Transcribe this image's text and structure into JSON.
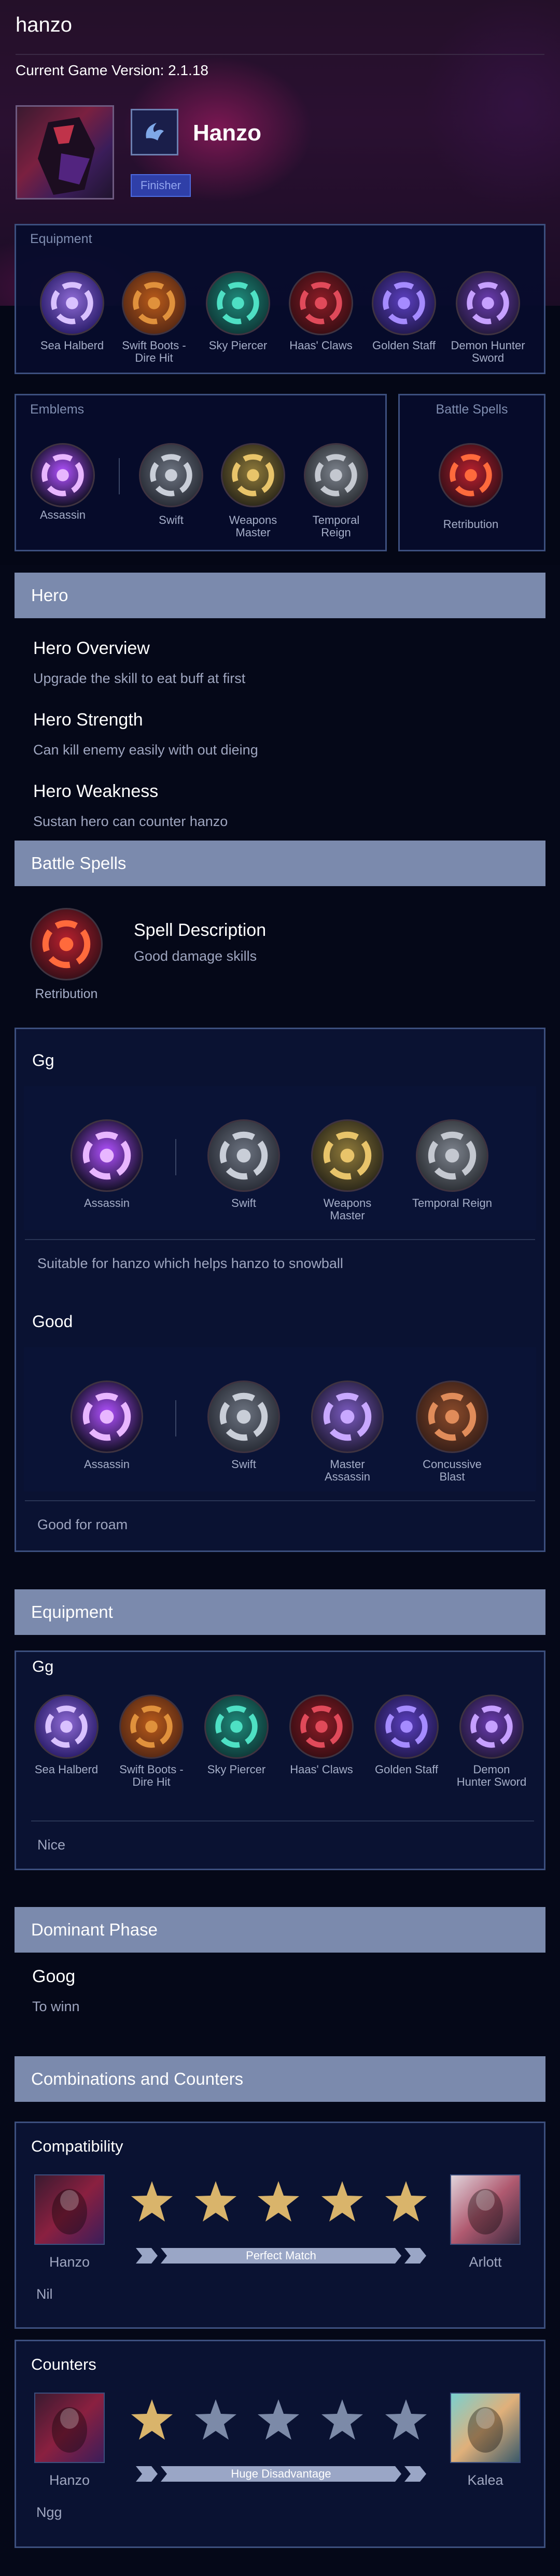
{
  "page_title": "hanzo",
  "version_text": "Current Game Version: 2.1.18",
  "hero": {
    "name": "Hanzo",
    "role_badge": "Finisher"
  },
  "top_equipment": {
    "title": "Equipment",
    "items": [
      "Sea Halberd",
      "Swift Boots - Dire Hit",
      "Sky Piercer",
      "Haas' Claws",
      "Golden Staff",
      "Demon Hunter Sword"
    ]
  },
  "top_emblems": {
    "title": "Emblems",
    "main": "Assassin",
    "talents": [
      "Swift",
      "Weapons Master",
      "Temporal Reign"
    ]
  },
  "top_spells": {
    "title": "Battle Spells",
    "spell": "Retribution"
  },
  "hero_section": {
    "title": "Hero",
    "overview_title": "Hero Overview",
    "overview": "Upgrade the skill to eat buff at first",
    "strength_title": "Hero Strength",
    "strength": "Can kill enemy easily with out dieing",
    "weakness_title": "Hero Weakness",
    "weakness": "Sustan hero can counter hanzo"
  },
  "spell_section": {
    "title": "Battle Spells",
    "spell": "Retribution",
    "desc_title": "Spell Description",
    "desc": "Good damage skills"
  },
  "emblem_builds": [
    {
      "name": "Gg",
      "main": "Assassin",
      "talents": [
        "Swift",
        "Weapons Master",
        "Temporal Reign"
      ],
      "note": "Suitable for hanzo which helps hanzo to snowball"
    },
    {
      "name": "Good",
      "main": "Assassin",
      "talents": [
        "Swift",
        "Master Assassin",
        "Concussive Blast"
      ],
      "note": "Good for roam"
    }
  ],
  "equipment_section": {
    "title": "Equipment",
    "build_name": "Gg",
    "items": [
      "Sea Halberd",
      "Swift Boots - Dire Hit",
      "Sky Piercer",
      "Haas' Claws",
      "Golden Staff",
      "Demon Hunter Sword"
    ],
    "note": "Nice"
  },
  "phase_section": {
    "title": "Dominant Phase",
    "phase": "Goog",
    "desc": "To winn"
  },
  "combo_section": {
    "title": "Combinations and Counters",
    "compat": {
      "title": "Compatibility",
      "left": "Hanzo",
      "right": "Arlott",
      "stars": 5,
      "label": "Perfect Match",
      "note": "Nil"
    },
    "counters": {
      "title": "Counters",
      "left": "Hanzo",
      "right": "Kalea",
      "stars": 1,
      "label": "Huge Disadvantage",
      "note": "Ngg"
    }
  },
  "colors": {
    "bar": "#7b8aad",
    "panel_border": "#3c4f7e",
    "star_gold": "#d9b46b",
    "star_gray": "#7c8aa8",
    "badge": "#2f3fa8"
  }
}
